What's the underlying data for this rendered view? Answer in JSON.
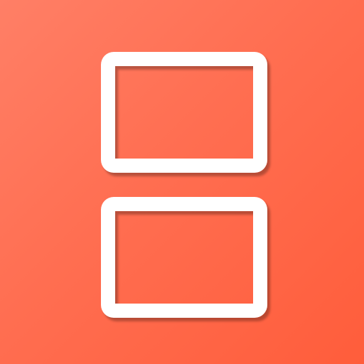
{
  "app_icon": {
    "icon_name": "dual-screen-icon",
    "colors": {
      "background_gradient_start": "#ff7f66",
      "background_gradient_end": "#ff5d3b",
      "outline": "#ffffff"
    }
  }
}
